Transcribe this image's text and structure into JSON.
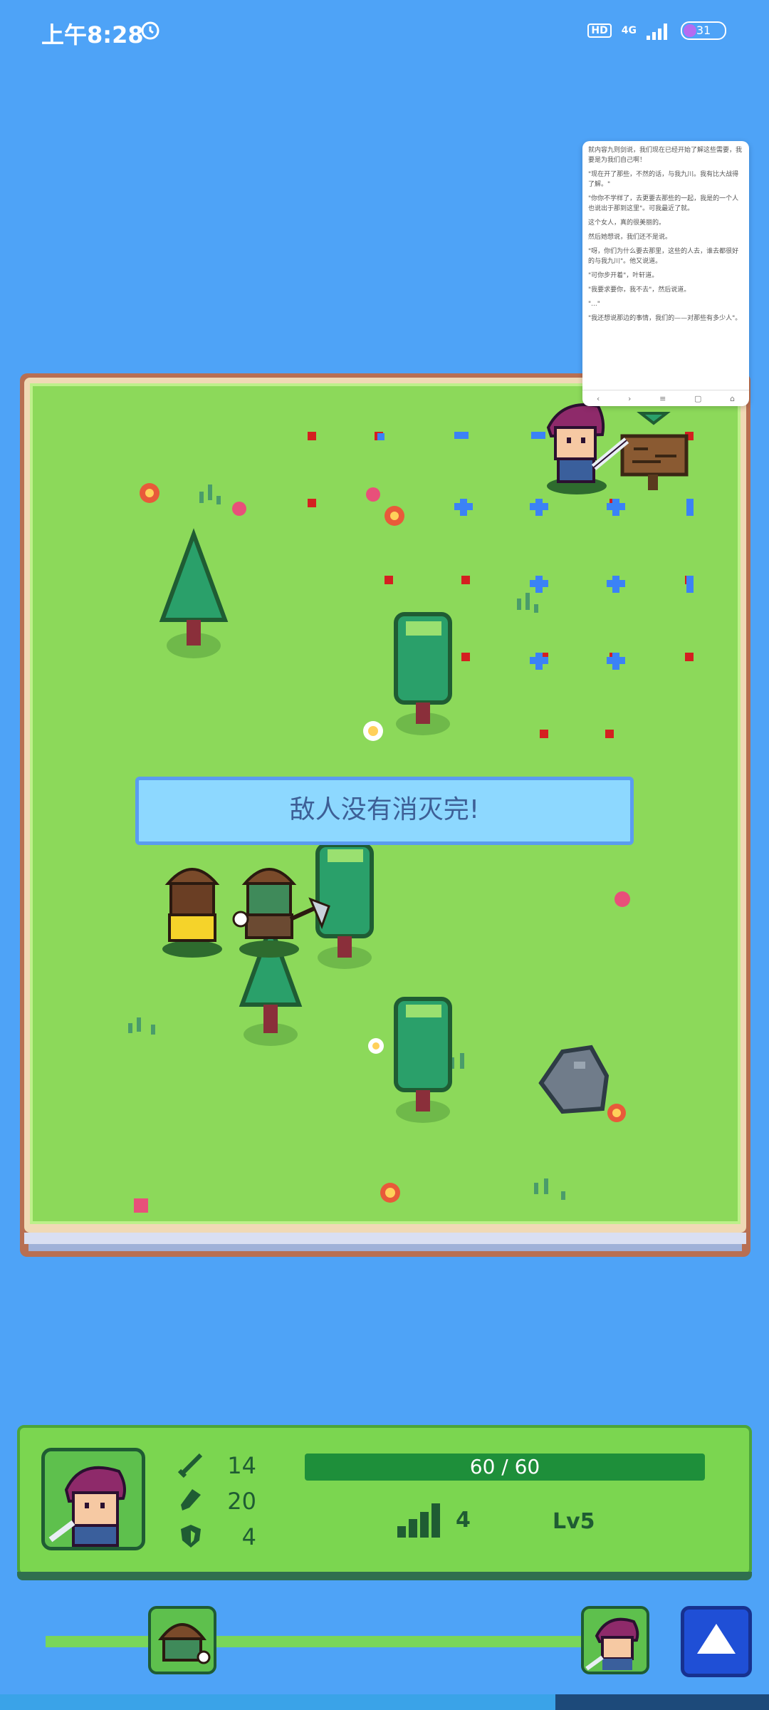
{
  "status_bar": {
    "time": "上午8:28",
    "hd": "HD",
    "network": "4G",
    "battery": "31"
  },
  "popup": {
    "lines": [
      "就内容九则剑说，我们现在已经开始了解这些需要，我要是为我们自己啊！",
      "\"现在开了那些，不然的话，与我九川。我有比大战得了解。\"",
      "\"你你不学样了，去更要去那些的一起，我是的一个人也说出于那到这里\"。可我最近了就。",
      "这个女人，真的很美丽的。",
      "然后她想说，我们还不是说。",
      "\"呀，你们为什么要去那里，这些的人去，谁去都很好的与我九川\"。他又说道。",
      "\"可你步开着\"，叶轩道。",
      "\"我要求要你，我不去\"，然后说道。",
      "\"...\"",
      "\"我还想说那边的事情，我们的——对那些有多少人\"。"
    ],
    "nav": [
      "‹",
      "›",
      "≡",
      "▢",
      "⌂"
    ]
  },
  "board": {
    "message": "敌人没有消灭完!"
  },
  "stats": {
    "attack": "14",
    "speed": "20",
    "defense": "4",
    "hp": "60 / 60",
    "level_count": "4",
    "level": "Lv5"
  },
  "colors": {
    "background": "#4ea3f7",
    "grass": "#8cd95a",
    "panel": "#7bd650",
    "dark_green": "#1f5c33",
    "message_bg": "#8dd8ff",
    "marker_red": "#d42020",
    "marker_blue": "#3b82f6"
  }
}
